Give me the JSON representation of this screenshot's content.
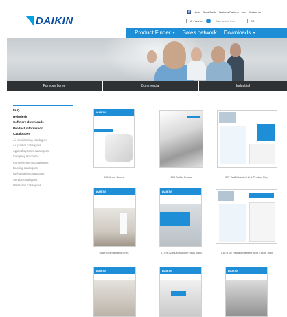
{
  "brand": {
    "logo_text": "DAIKIN"
  },
  "toplinks": {
    "facebook_glyph": "f",
    "items": [
      "Home",
      "About Daikin",
      "Business Partners",
      "Jobs",
      "Contact us"
    ]
  },
  "utility": {
    "favourites": "My Favorites",
    "search_placeholder": "Enter search term",
    "go_label": "GO"
  },
  "nav": {
    "items": [
      "Product Finder",
      "Sales network",
      "Downloads"
    ]
  },
  "tabs": [
    "For your home",
    "Commercial",
    "Industrial"
  ],
  "sidebar": {
    "bold_items": [
      "FAQ",
      "Helpdesk",
      "Software downloads",
      "Product information",
      "Catalogues"
    ],
    "sub_items": [
      "Air conditioning catalogues",
      "Air purifier catalogues",
      "Applied systems catalogues",
      "Company brochures",
      "Control systems catalogues",
      "Heating catalogues",
      "Refrigeration catalogues",
      "Service catalogues",
      "Ventilation catalogues"
    ]
  },
  "products": [
    {
      "caption": "005 Ururu Sarara"
    },
    {
      "caption": "005 Daikin Emura"
    },
    {
      "caption": "007 Wall Mounted Unit Product Flyer"
    },
    {
      "caption": "008 Floor Standing Units"
    },
    {
      "caption": "017 R-32 Bluevolution Focus Topic"
    },
    {
      "caption": "018 R-32 Replacement for Split Focus Topic"
    },
    {
      "caption": ""
    },
    {
      "caption": ""
    },
    {
      "caption": ""
    }
  ],
  "colors": {
    "accent": "#1e8fd6",
    "logo": "#0a4ea2",
    "tab_dark": "#2f3234"
  }
}
